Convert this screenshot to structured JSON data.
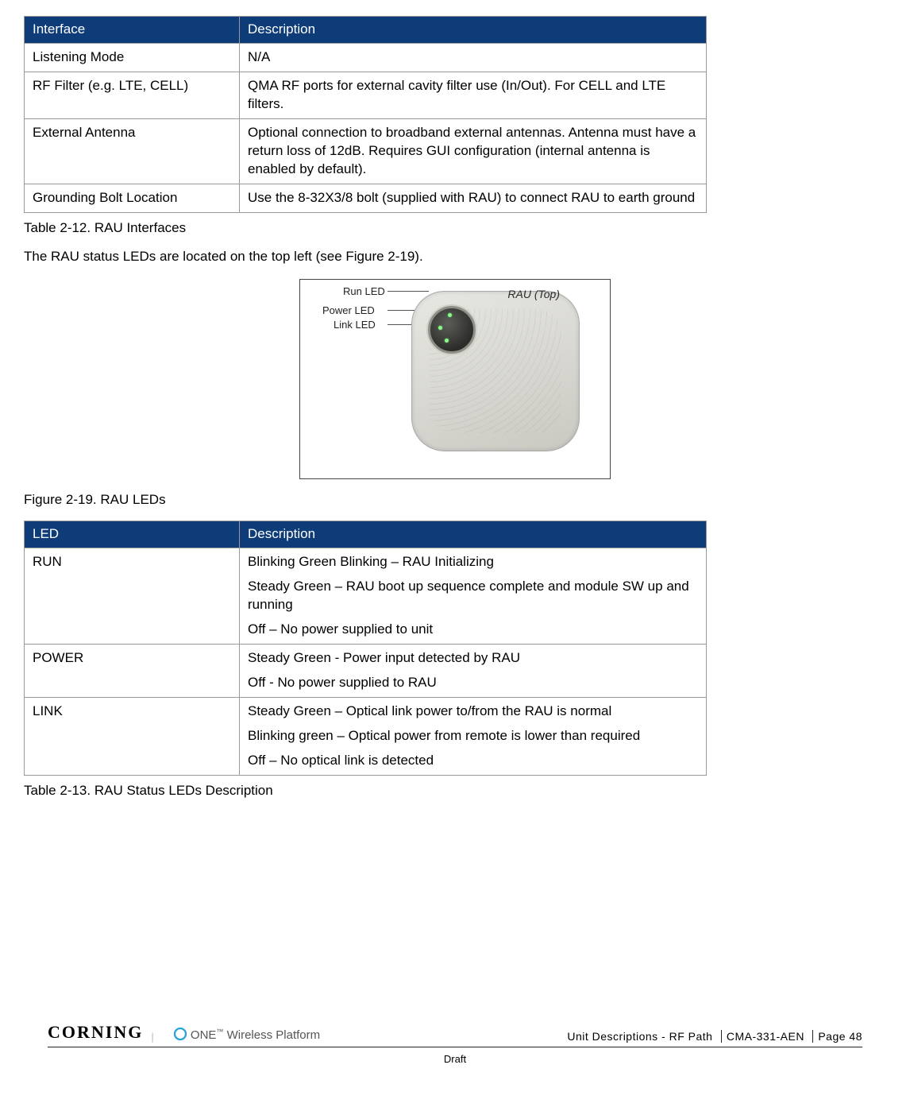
{
  "table1": {
    "headers": [
      "Interface",
      "Description"
    ],
    "rows": [
      [
        "Listening Mode",
        "N/A"
      ],
      [
        "RF Filter (e.g. LTE, CELL)",
        "QMA RF ports for external cavity filter use (In/Out). For CELL and LTE filters."
      ],
      [
        "External Antenna",
        "Optional connection to broadband external antennas. Antenna must have a return loss of 12dB. Requires GUI configuration (internal antenna is enabled by default)."
      ],
      [
        "Grounding Bolt Location",
        "Use the 8-32X3/8 bolt (supplied with RAU) to connect RAU to earth ground"
      ]
    ],
    "caption": "Table 2-12. RAU Interfaces"
  },
  "para1": "The RAU status LEDs are located on the top left (see Figure 2-19).",
  "figure": {
    "labels": {
      "run": "Run LED",
      "power": "Power LED",
      "link": "Link LED",
      "top": "RAU (Top)"
    },
    "caption": "Figure 2-19. RAU LEDs"
  },
  "table2": {
    "headers": [
      "LED",
      "Description"
    ],
    "rows": [
      {
        "c1": "RUN",
        "c2": [
          "Blinking Green Blinking – RAU Initializing",
          "Steady Green – RAU boot up sequence complete and module SW up and running",
          "Off – No power supplied to unit"
        ]
      },
      {
        "c1": "POWER",
        "c2": [
          "Steady Green - Power input detected by RAU",
          "Off - No power supplied to RAU"
        ]
      },
      {
        "c1": "LINK",
        "c2": [
          "Steady Green – Optical link power to/from the RAU is normal",
          "Blinking green – Optical power from remote is lower than required",
          "Off – No optical link is detected"
        ]
      }
    ],
    "caption": "Table 2-13. RAU Status LEDs Description"
  },
  "footer": {
    "logo": "CORNING",
    "sub_pre": "ONE",
    "sub_post": " Wireless Platform",
    "section": "Unit Descriptions - RF Path",
    "doc": "CMA-331-AEN",
    "page": "Page 48",
    "draft": "Draft"
  }
}
